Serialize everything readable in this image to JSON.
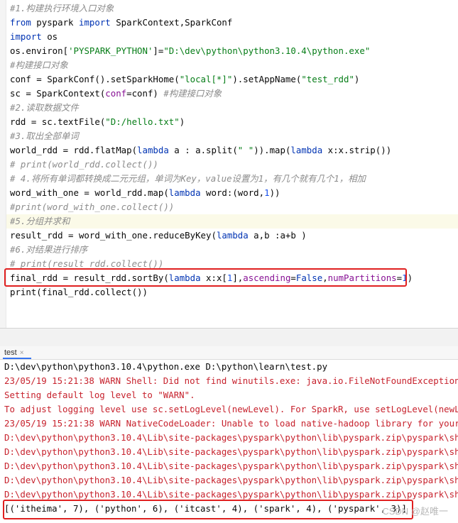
{
  "editor": {
    "lines": [
      {
        "parts": [
          {
            "t": "#1.构建执行环境入口对象",
            "c": "cm"
          }
        ]
      },
      {
        "parts": [
          {
            "t": "from",
            "c": "kw"
          },
          {
            "t": " pyspark ",
            "c": "fn"
          },
          {
            "t": "import",
            "c": "kw"
          },
          {
            "t": " SparkContext,SparkConf",
            "c": "fn"
          }
        ]
      },
      {
        "parts": [
          {
            "t": "import",
            "c": "kw"
          },
          {
            "t": " os",
            "c": "fn"
          }
        ]
      },
      {
        "parts": [
          {
            "t": "os.environ[",
            "c": "fn"
          },
          {
            "t": "'PYSPARK_PYTHON'",
            "c": "st"
          },
          {
            "t": "]=",
            "c": "fn"
          },
          {
            "t": "\"D:\\dev\\python\\python3.10.4\\python.exe\"",
            "c": "st"
          }
        ]
      },
      {
        "parts": [
          {
            "t": "#构建接口对象",
            "c": "cm"
          }
        ]
      },
      {
        "parts": [
          {
            "t": "conf = SparkConf().setSparkHome(",
            "c": "fn"
          },
          {
            "t": "\"local[*]\"",
            "c": "st"
          },
          {
            "t": ").setAppName(",
            "c": "fn"
          },
          {
            "t": "\"test_rdd\"",
            "c": "st"
          },
          {
            "t": ")",
            "c": "fn"
          }
        ]
      },
      {
        "parts": [
          {
            "t": "sc = SparkContext(",
            "c": "fn"
          },
          {
            "t": "conf",
            "c": "pr"
          },
          {
            "t": "=conf) ",
            "c": "fn"
          },
          {
            "t": "#构建接口对象",
            "c": "cm"
          }
        ]
      },
      {
        "parts": [
          {
            "t": "#2.读取数据文件",
            "c": "cm"
          }
        ]
      },
      {
        "parts": [
          {
            "t": "rdd = sc.textFile(",
            "c": "fn"
          },
          {
            "t": "\"D:/hello.txt\"",
            "c": "st"
          },
          {
            "t": ")",
            "c": "fn"
          }
        ]
      },
      {
        "parts": [
          {
            "t": "#3.取出全部单词",
            "c": "cm"
          }
        ]
      },
      {
        "parts": [
          {
            "t": "world_rdd = rdd.flatMap(",
            "c": "fn"
          },
          {
            "t": "lambda",
            "c": "kw"
          },
          {
            "t": " a : a.split(",
            "c": "fn"
          },
          {
            "t": "\" \"",
            "c": "st"
          },
          {
            "t": ")).map(",
            "c": "fn"
          },
          {
            "t": "lambda",
            "c": "kw"
          },
          {
            "t": " x:x.strip())",
            "c": "fn"
          }
        ]
      },
      {
        "parts": [
          {
            "t": "# print(world_rdd.collect())",
            "c": "cm"
          }
        ]
      },
      {
        "parts": [
          {
            "t": "# 4.将所有单词都转换成二元元组，单词为Key，value设置为1，有几个就有几个1，相加",
            "c": "cm"
          }
        ]
      },
      {
        "parts": [
          {
            "t": "word_with_one = world_rdd.map(",
            "c": "fn"
          },
          {
            "t": "lambda",
            "c": "kw"
          },
          {
            "t": " word:(word,",
            "c": "fn"
          },
          {
            "t": "1",
            "c": "nm"
          },
          {
            "t": "))",
            "c": "fn"
          }
        ]
      },
      {
        "parts": [
          {
            "t": "#print(word_with_one.collect())",
            "c": "cm"
          }
        ]
      },
      {
        "parts": [
          {
            "t": "#5.分组并求和",
            "c": "cm"
          }
        ]
      },
      {
        "parts": [
          {
            "t": "result_rdd = word_with_one.reduceByKey(",
            "c": "fn"
          },
          {
            "t": "lambda",
            "c": "kw"
          },
          {
            "t": " a,b :a+b )",
            "c": "fn"
          }
        ]
      },
      {
        "parts": [
          {
            "t": "#6.对结果进行排序",
            "c": "cm"
          }
        ]
      },
      {
        "parts": [
          {
            "t": "# print(result_rdd.collect())",
            "c": "cm"
          }
        ]
      },
      {
        "parts": [
          {
            "t": "final_rdd = result_rdd.sortBy(",
            "c": "fn"
          },
          {
            "t": "lambda",
            "c": "kw"
          },
          {
            "t": " x:x[",
            "c": "fn"
          },
          {
            "t": "1",
            "c": "nm"
          },
          {
            "t": "],",
            "c": "fn"
          },
          {
            "t": "ascending",
            "c": "pr"
          },
          {
            "t": "=",
            "c": "fn"
          },
          {
            "t": "False",
            "c": "kw"
          },
          {
            "t": ",",
            "c": "fn"
          },
          {
            "t": "numPartitions",
            "c": "pr"
          },
          {
            "t": "=",
            "c": "fn"
          },
          {
            "t": "1",
            "c": "nm"
          },
          {
            "t": ")",
            "c": "fn"
          }
        ]
      },
      {
        "parts": [
          {
            "t": "print(final_rdd.collect())",
            "c": "fn"
          }
        ]
      }
    ]
  },
  "run_panel": {
    "tab_label": "test",
    "close_glyph": "×"
  },
  "console": {
    "lines": [
      {
        "text": "D:\\dev\\python\\python3.10.4\\python.exe D:\\python\\learn\\test.py",
        "c": "out-normal"
      },
      {
        "text": "23/05/19 15:21:38 WARN Shell: Did not find winutils.exe: java.io.FileNotFoundException: ",
        "c": "out-err"
      },
      {
        "text": "Setting default log level to \"WARN\".",
        "c": "out-err"
      },
      {
        "text": "To adjust logging level use sc.setLogLevel(newLevel). For SparkR, use setLogLevel(newLev",
        "c": "out-err"
      },
      {
        "text": "23/05/19 15:21:38 WARN NativeCodeLoader: Unable to load native-hadoop library for your p",
        "c": "out-err"
      },
      {
        "text": "D:\\dev\\python\\python3.10.4\\Lib\\site-packages\\pyspark\\python\\lib\\pyspark.zip\\pyspark\\shuf",
        "c": "out-err"
      },
      {
        "text": "D:\\dev\\python\\python3.10.4\\Lib\\site-packages\\pyspark\\python\\lib\\pyspark.zip\\pyspark\\shuf",
        "c": "out-err"
      },
      {
        "text": "D:\\dev\\python\\python3.10.4\\Lib\\site-packages\\pyspark\\python\\lib\\pyspark.zip\\pyspark\\shuf",
        "c": "out-err"
      },
      {
        "text": "D:\\dev\\python\\python3.10.4\\Lib\\site-packages\\pyspark\\python\\lib\\pyspark.zip\\pyspark\\shuf",
        "c": "out-err"
      },
      {
        "text": "D:\\dev\\python\\python3.10.4\\Lib\\site-packages\\pyspark\\python\\lib\\pyspark.zip\\pyspark\\shuf",
        "c": "out-err"
      },
      {
        "text": "[('itheima', 7), ('python', 6), ('itcast', 4), ('spark', 4), ('pyspark', 3)]",
        "c": "out-normal"
      }
    ]
  },
  "watermark": "CSDN @赵唯一"
}
